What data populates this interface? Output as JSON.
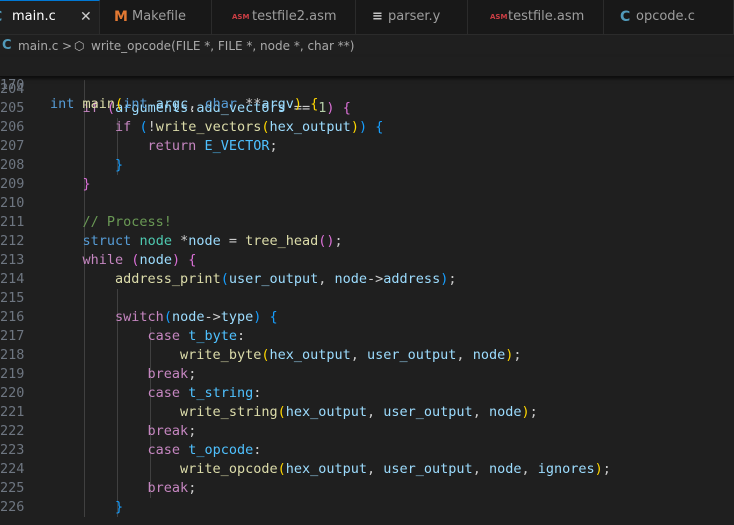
{
  "tabs": [
    {
      "icon_name": "c-file-icon",
      "icon_glyph": "C",
      "label": "main.c",
      "active": true,
      "close_glyph": "✕"
    },
    {
      "icon_name": "makefile-icon",
      "icon_glyph": "M",
      "label": "Makefile"
    },
    {
      "icon_name": "asm-file-icon",
      "icon_glyph": "ASM",
      "label": "testfile2.asm"
    },
    {
      "icon_name": "yacc-file-icon",
      "icon_glyph": "≡",
      "label": "parser.y"
    },
    {
      "icon_name": "asm-file-icon",
      "icon_glyph": "ASM",
      "label": "testfile.asm"
    },
    {
      "icon_name": "c-file-icon",
      "icon_glyph": "C",
      "label": "opcode.c"
    }
  ],
  "breadcrumb": {
    "file_icon_glyph": "C",
    "file": "main.c",
    "separator": ">",
    "symbol_icon_glyph": "⬡",
    "symbol": "write_opcode(FILE *, FILE *, node *, char **)"
  },
  "sticky_line": {
    "number": "170",
    "tokens": [
      {
        "t": "int",
        "c": "kw"
      },
      {
        "t": " "
      },
      {
        "t": "main",
        "c": "fn"
      },
      {
        "t": "(",
        "c": "p1"
      },
      {
        "t": "int",
        "c": "kw"
      },
      {
        "t": " "
      },
      {
        "t": "argc",
        "c": "var"
      },
      {
        "t": ", "
      },
      {
        "t": "char",
        "c": "kw"
      },
      {
        "t": " **"
      },
      {
        "t": "argv",
        "c": "var"
      },
      {
        "t": ")",
        "c": "p1"
      },
      {
        "t": " "
      },
      {
        "t": "{",
        "c": "p1"
      }
    ]
  },
  "code_lines": [
    {
      "n": "204",
      "tokens": []
    },
    {
      "n": "205",
      "tokens": [
        {
          "t": "    "
        },
        {
          "t": "if",
          "c": "ctl"
        },
        {
          "t": " "
        },
        {
          "t": "(",
          "c": "p2"
        },
        {
          "t": "arguments",
          "c": "var"
        },
        {
          "t": "."
        },
        {
          "t": "add_vectors",
          "c": "var"
        },
        {
          "t": " == "
        },
        {
          "t": "1",
          "c": "num"
        },
        {
          "t": ")",
          "c": "p2"
        },
        {
          "t": " "
        },
        {
          "t": "{",
          "c": "p2"
        }
      ]
    },
    {
      "n": "206",
      "tokens": [
        {
          "t": "        "
        },
        {
          "t": "if",
          "c": "ctl"
        },
        {
          "t": " "
        },
        {
          "t": "(",
          "c": "p3"
        },
        {
          "t": "!"
        },
        {
          "t": "write_vectors",
          "c": "fn"
        },
        {
          "t": "(",
          "c": "p1"
        },
        {
          "t": "hex_output",
          "c": "var"
        },
        {
          "t": ")",
          "c": "p1"
        },
        {
          "t": ")",
          "c": "p3"
        },
        {
          "t": " "
        },
        {
          "t": "{",
          "c": "p3"
        }
      ]
    },
    {
      "n": "207",
      "tokens": [
        {
          "t": "            "
        },
        {
          "t": "return",
          "c": "ctl"
        },
        {
          "t": " "
        },
        {
          "t": "E_VECTOR",
          "c": "con"
        },
        {
          "t": ";"
        }
      ]
    },
    {
      "n": "208",
      "tokens": [
        {
          "t": "        "
        },
        {
          "t": "}",
          "c": "p3"
        }
      ]
    },
    {
      "n": "209",
      "tokens": [
        {
          "t": "    "
        },
        {
          "t": "}",
          "c": "p2"
        }
      ]
    },
    {
      "n": "210",
      "tokens": []
    },
    {
      "n": "211",
      "tokens": [
        {
          "t": "    "
        },
        {
          "t": "// Process!",
          "c": "cmt"
        }
      ]
    },
    {
      "n": "212",
      "tokens": [
        {
          "t": "    "
        },
        {
          "t": "struct",
          "c": "kw"
        },
        {
          "t": " "
        },
        {
          "t": "node",
          "c": "typ"
        },
        {
          "t": " *"
        },
        {
          "t": "node",
          "c": "var"
        },
        {
          "t": " = "
        },
        {
          "t": "tree_head",
          "c": "fn"
        },
        {
          "t": "()",
          "c": "p2"
        },
        {
          "t": ";"
        }
      ]
    },
    {
      "n": "213",
      "tokens": [
        {
          "t": "    "
        },
        {
          "t": "while",
          "c": "ctl"
        },
        {
          "t": " "
        },
        {
          "t": "(",
          "c": "p2"
        },
        {
          "t": "node",
          "c": "var"
        },
        {
          "t": ")",
          "c": "p2"
        },
        {
          "t": " "
        },
        {
          "t": "{",
          "c": "p2"
        }
      ]
    },
    {
      "n": "214",
      "tokens": [
        {
          "t": "        "
        },
        {
          "t": "address_print",
          "c": "fn"
        },
        {
          "t": "(",
          "c": "p3"
        },
        {
          "t": "user_output",
          "c": "var"
        },
        {
          "t": ", "
        },
        {
          "t": "node",
          "c": "var"
        },
        {
          "t": "->"
        },
        {
          "t": "address",
          "c": "var"
        },
        {
          "t": ")",
          "c": "p3"
        },
        {
          "t": ";"
        }
      ]
    },
    {
      "n": "215",
      "tokens": []
    },
    {
      "n": "216",
      "tokens": [
        {
          "t": "        "
        },
        {
          "t": "switch",
          "c": "ctl"
        },
        {
          "t": "(",
          "c": "p3"
        },
        {
          "t": "node",
          "c": "var"
        },
        {
          "t": "->"
        },
        {
          "t": "type",
          "c": "var"
        },
        {
          "t": ")",
          "c": "p3"
        },
        {
          "t": " "
        },
        {
          "t": "{",
          "c": "p3"
        }
      ]
    },
    {
      "n": "217",
      "tokens": [
        {
          "t": "            "
        },
        {
          "t": "case",
          "c": "ctl"
        },
        {
          "t": " "
        },
        {
          "t": "t_byte",
          "c": "con"
        },
        {
          "t": ":"
        }
      ]
    },
    {
      "n": "218",
      "tokens": [
        {
          "t": "                "
        },
        {
          "t": "write_byte",
          "c": "fn"
        },
        {
          "t": "(",
          "c": "p1"
        },
        {
          "t": "hex_output",
          "c": "var"
        },
        {
          "t": ", "
        },
        {
          "t": "user_output",
          "c": "var"
        },
        {
          "t": ", "
        },
        {
          "t": "node",
          "c": "var"
        },
        {
          "t": ")",
          "c": "p1"
        },
        {
          "t": ";"
        }
      ]
    },
    {
      "n": "219",
      "tokens": [
        {
          "t": "            "
        },
        {
          "t": "break",
          "c": "ctl"
        },
        {
          "t": ";"
        }
      ]
    },
    {
      "n": "220",
      "tokens": [
        {
          "t": "            "
        },
        {
          "t": "case",
          "c": "ctl"
        },
        {
          "t": " "
        },
        {
          "t": "t_string",
          "c": "con"
        },
        {
          "t": ":"
        }
      ]
    },
    {
      "n": "221",
      "tokens": [
        {
          "t": "                "
        },
        {
          "t": "write_string",
          "c": "fn"
        },
        {
          "t": "(",
          "c": "p1"
        },
        {
          "t": "hex_output",
          "c": "var"
        },
        {
          "t": ", "
        },
        {
          "t": "user_output",
          "c": "var"
        },
        {
          "t": ", "
        },
        {
          "t": "node",
          "c": "var"
        },
        {
          "t": ")",
          "c": "p1"
        },
        {
          "t": ";"
        }
      ]
    },
    {
      "n": "222",
      "tokens": [
        {
          "t": "            "
        },
        {
          "t": "break",
          "c": "ctl"
        },
        {
          "t": ";"
        }
      ]
    },
    {
      "n": "223",
      "tokens": [
        {
          "t": "            "
        },
        {
          "t": "case",
          "c": "ctl"
        },
        {
          "t": " "
        },
        {
          "t": "t_opcode",
          "c": "con"
        },
        {
          "t": ":"
        }
      ]
    },
    {
      "n": "224",
      "tokens": [
        {
          "t": "                "
        },
        {
          "t": "write_opcode",
          "c": "fn"
        },
        {
          "t": "(",
          "c": "p1"
        },
        {
          "t": "hex_output",
          "c": "var"
        },
        {
          "t": ", "
        },
        {
          "t": "user_output",
          "c": "var"
        },
        {
          "t": ", "
        },
        {
          "t": "node",
          "c": "var"
        },
        {
          "t": ", "
        },
        {
          "t": "ignores",
          "c": "var"
        },
        {
          "t": ")",
          "c": "p1"
        },
        {
          "t": ";"
        }
      ]
    },
    {
      "n": "225",
      "tokens": [
        {
          "t": "            "
        },
        {
          "t": "break",
          "c": "ctl"
        },
        {
          "t": ";"
        }
      ]
    },
    {
      "n": "226",
      "tokens": [
        {
          "t": "        "
        },
        {
          "t": "}",
          "c": "p3"
        }
      ]
    }
  ],
  "theme": {
    "editor_bg": "#1f1f1f",
    "tabbar_bg": "#181818",
    "active_tab_accent": "#0078d4",
    "line_number": "#6e7681"
  }
}
